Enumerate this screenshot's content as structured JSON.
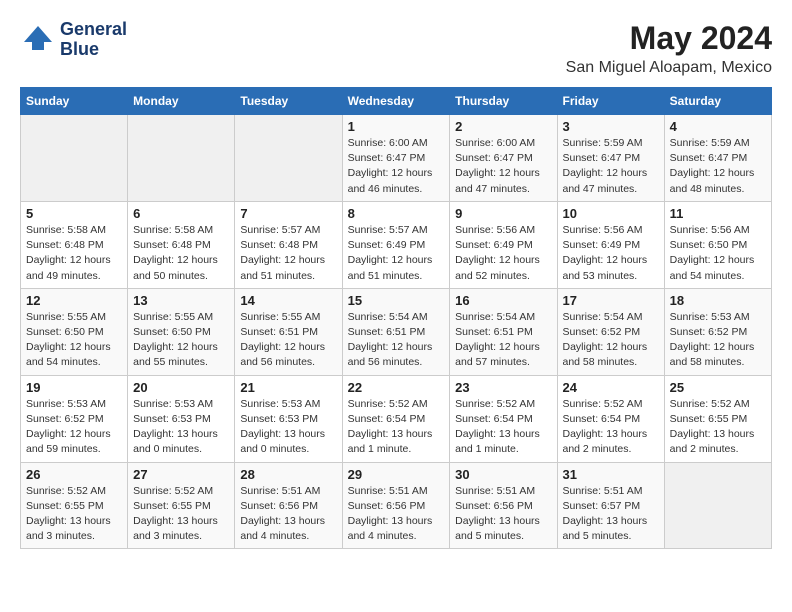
{
  "header": {
    "logo_line1": "General",
    "logo_line2": "Blue",
    "month": "May 2024",
    "location": "San Miguel Aloapam, Mexico"
  },
  "days_of_week": [
    "Sunday",
    "Monday",
    "Tuesday",
    "Wednesday",
    "Thursday",
    "Friday",
    "Saturday"
  ],
  "weeks": [
    [
      {
        "day": "",
        "info": ""
      },
      {
        "day": "",
        "info": ""
      },
      {
        "day": "",
        "info": ""
      },
      {
        "day": "1",
        "info": "Sunrise: 6:00 AM\nSunset: 6:47 PM\nDaylight: 12 hours\nand 46 minutes."
      },
      {
        "day": "2",
        "info": "Sunrise: 6:00 AM\nSunset: 6:47 PM\nDaylight: 12 hours\nand 47 minutes."
      },
      {
        "day": "3",
        "info": "Sunrise: 5:59 AM\nSunset: 6:47 PM\nDaylight: 12 hours\nand 47 minutes."
      },
      {
        "day": "4",
        "info": "Sunrise: 5:59 AM\nSunset: 6:47 PM\nDaylight: 12 hours\nand 48 minutes."
      }
    ],
    [
      {
        "day": "5",
        "info": "Sunrise: 5:58 AM\nSunset: 6:48 PM\nDaylight: 12 hours\nand 49 minutes."
      },
      {
        "day": "6",
        "info": "Sunrise: 5:58 AM\nSunset: 6:48 PM\nDaylight: 12 hours\nand 50 minutes."
      },
      {
        "day": "7",
        "info": "Sunrise: 5:57 AM\nSunset: 6:48 PM\nDaylight: 12 hours\nand 51 minutes."
      },
      {
        "day": "8",
        "info": "Sunrise: 5:57 AM\nSunset: 6:49 PM\nDaylight: 12 hours\nand 51 minutes."
      },
      {
        "day": "9",
        "info": "Sunrise: 5:56 AM\nSunset: 6:49 PM\nDaylight: 12 hours\nand 52 minutes."
      },
      {
        "day": "10",
        "info": "Sunrise: 5:56 AM\nSunset: 6:49 PM\nDaylight: 12 hours\nand 53 minutes."
      },
      {
        "day": "11",
        "info": "Sunrise: 5:56 AM\nSunset: 6:50 PM\nDaylight: 12 hours\nand 54 minutes."
      }
    ],
    [
      {
        "day": "12",
        "info": "Sunrise: 5:55 AM\nSunset: 6:50 PM\nDaylight: 12 hours\nand 54 minutes."
      },
      {
        "day": "13",
        "info": "Sunrise: 5:55 AM\nSunset: 6:50 PM\nDaylight: 12 hours\nand 55 minutes."
      },
      {
        "day": "14",
        "info": "Sunrise: 5:55 AM\nSunset: 6:51 PM\nDaylight: 12 hours\nand 56 minutes."
      },
      {
        "day": "15",
        "info": "Sunrise: 5:54 AM\nSunset: 6:51 PM\nDaylight: 12 hours\nand 56 minutes."
      },
      {
        "day": "16",
        "info": "Sunrise: 5:54 AM\nSunset: 6:51 PM\nDaylight: 12 hours\nand 57 minutes."
      },
      {
        "day": "17",
        "info": "Sunrise: 5:54 AM\nSunset: 6:52 PM\nDaylight: 12 hours\nand 58 minutes."
      },
      {
        "day": "18",
        "info": "Sunrise: 5:53 AM\nSunset: 6:52 PM\nDaylight: 12 hours\nand 58 minutes."
      }
    ],
    [
      {
        "day": "19",
        "info": "Sunrise: 5:53 AM\nSunset: 6:52 PM\nDaylight: 12 hours\nand 59 minutes."
      },
      {
        "day": "20",
        "info": "Sunrise: 5:53 AM\nSunset: 6:53 PM\nDaylight: 13 hours\nand 0 minutes."
      },
      {
        "day": "21",
        "info": "Sunrise: 5:53 AM\nSunset: 6:53 PM\nDaylight: 13 hours\nand 0 minutes."
      },
      {
        "day": "22",
        "info": "Sunrise: 5:52 AM\nSunset: 6:54 PM\nDaylight: 13 hours\nand 1 minute."
      },
      {
        "day": "23",
        "info": "Sunrise: 5:52 AM\nSunset: 6:54 PM\nDaylight: 13 hours\nand 1 minute."
      },
      {
        "day": "24",
        "info": "Sunrise: 5:52 AM\nSunset: 6:54 PM\nDaylight: 13 hours\nand 2 minutes."
      },
      {
        "day": "25",
        "info": "Sunrise: 5:52 AM\nSunset: 6:55 PM\nDaylight: 13 hours\nand 2 minutes."
      }
    ],
    [
      {
        "day": "26",
        "info": "Sunrise: 5:52 AM\nSunset: 6:55 PM\nDaylight: 13 hours\nand 3 minutes."
      },
      {
        "day": "27",
        "info": "Sunrise: 5:52 AM\nSunset: 6:55 PM\nDaylight: 13 hours\nand 3 minutes."
      },
      {
        "day": "28",
        "info": "Sunrise: 5:51 AM\nSunset: 6:56 PM\nDaylight: 13 hours\nand 4 minutes."
      },
      {
        "day": "29",
        "info": "Sunrise: 5:51 AM\nSunset: 6:56 PM\nDaylight: 13 hours\nand 4 minutes."
      },
      {
        "day": "30",
        "info": "Sunrise: 5:51 AM\nSunset: 6:56 PM\nDaylight: 13 hours\nand 5 minutes."
      },
      {
        "day": "31",
        "info": "Sunrise: 5:51 AM\nSunset: 6:57 PM\nDaylight: 13 hours\nand 5 minutes."
      },
      {
        "day": "",
        "info": ""
      }
    ]
  ]
}
